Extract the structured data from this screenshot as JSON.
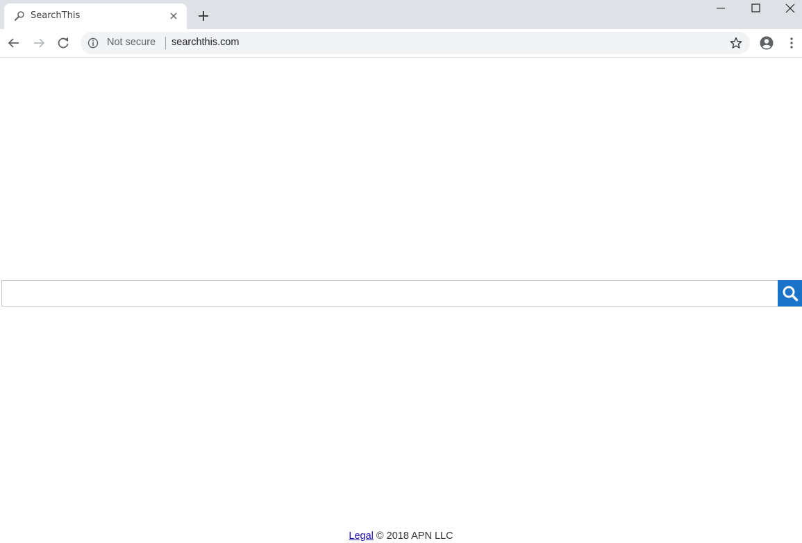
{
  "browser": {
    "tab": {
      "title": "SearchThis",
      "favicon": "search-magnifier-icon"
    },
    "address_bar": {
      "security_label": "Not secure",
      "url": "searchthis.com"
    },
    "icons": [
      "back-arrow-icon",
      "forward-arrow-icon",
      "reload-icon",
      "info-icon",
      "star-icon",
      "profile-icon",
      "menu-icon"
    ]
  },
  "search": {
    "input_value": "",
    "placeholder": "",
    "button_icon": "search-icon",
    "button_color": "#1a73c8"
  },
  "footer": {
    "legal_link": "Legal",
    "copyright": " © 2018 APN LLC"
  }
}
